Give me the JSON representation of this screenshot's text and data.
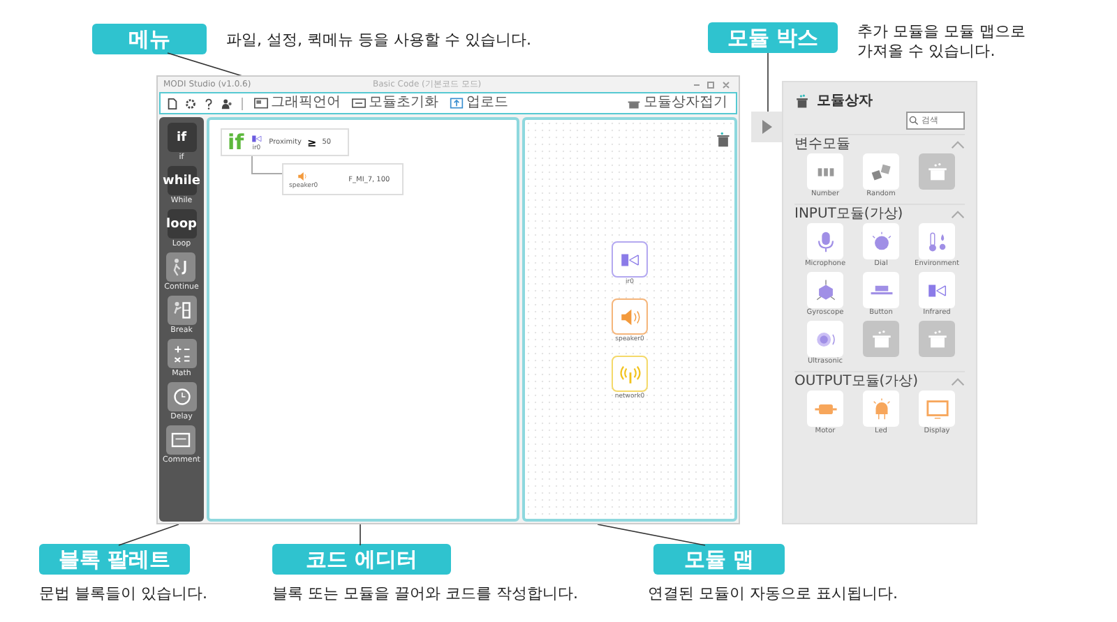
{
  "callouts": [
    {
      "kind": "menu",
      "label": "메뉴",
      "description": "파일, 설정, 퀵메뉴 등을 사용할 수 있습니다."
    },
    {
      "kind": "module_box",
      "label": "모듈 박스",
      "description": "추가 모듈을 모듈 맵으로 가져올 수 있습니다."
    },
    {
      "kind": "palette",
      "label": "블록 팔레트",
      "description": "문법 블록들이 있습니다."
    },
    {
      "kind": "editor",
      "label": "코드 에디터",
      "description": "블록 또는 모듈을 끌어와 코드를 작성합니다."
    },
    {
      "kind": "map",
      "label": "모듈 맵",
      "description": "연결된 모듈이 자동으로 표시됩니다."
    }
  ],
  "window": {
    "title": "MODI Studio (v1.0.6)",
    "document": "Basic Code (기본코드 모드)",
    "toolbar": [
      {
        "label": "그래픽언어",
        "kind": "graphic"
      },
      {
        "label": "모듈초기화",
        "kind": "reset"
      },
      {
        "label": "업로드",
        "kind": "upload"
      }
    ],
    "collapse_button": "모듈상자접기"
  },
  "palette": [
    {
      "kind": "if",
      "icon_text": "if",
      "label": "if"
    },
    {
      "kind": "while",
      "icon_text": "while",
      "label": "While"
    },
    {
      "kind": "loop",
      "icon_text": "loop",
      "label": "Loop"
    },
    {
      "kind": "continue",
      "label": "Continue"
    },
    {
      "kind": "break",
      "label": "Break"
    },
    {
      "kind": "math",
      "label": "Math"
    },
    {
      "kind": "delay",
      "label": "Delay"
    },
    {
      "kind": "comment",
      "label": "Comment"
    }
  ],
  "code": {
    "if_block": {
      "keyword": "if",
      "module": "ir0",
      "sensor": "Proximity",
      "operator": "≥",
      "value": "50"
    },
    "action_block": {
      "module": "speaker0",
      "value": "F_MI_7, 100"
    }
  },
  "module_map": [
    {
      "name": "ir0",
      "kind": "ir"
    },
    {
      "name": "speaker0",
      "kind": "speaker"
    },
    {
      "name": "network0",
      "kind": "network"
    }
  ],
  "module_box": {
    "title": "모듈상자",
    "search_placeholder": "검색",
    "sections": [
      {
        "title": "변수모듈",
        "expanded": true,
        "modules": [
          {
            "name": "Number",
            "kind": "number"
          },
          {
            "name": "Random",
            "kind": "random"
          },
          {
            "kind": "empty"
          }
        ]
      },
      {
        "title": "INPUT모듈(가상)",
        "expanded": true,
        "modules": [
          {
            "name": "Microphone",
            "kind": "mic"
          },
          {
            "name": "Dial",
            "kind": "dial"
          },
          {
            "name": "Environment",
            "kind": "env"
          },
          {
            "name": "Gyroscope",
            "kind": "gyro"
          },
          {
            "name": "Button",
            "kind": "button"
          },
          {
            "name": "Infrared",
            "kind": "ir"
          },
          {
            "name": "Ultrasonic",
            "kind": "ultra"
          },
          {
            "kind": "empty"
          },
          {
            "kind": "empty"
          }
        ]
      },
      {
        "title": "OUTPUT모듈(가상)",
        "expanded": true,
        "modules": [
          {
            "name": "Motor",
            "kind": "motor"
          },
          {
            "name": "Led",
            "kind": "led"
          },
          {
            "name": "Display",
            "kind": "display"
          }
        ]
      }
    ]
  }
}
